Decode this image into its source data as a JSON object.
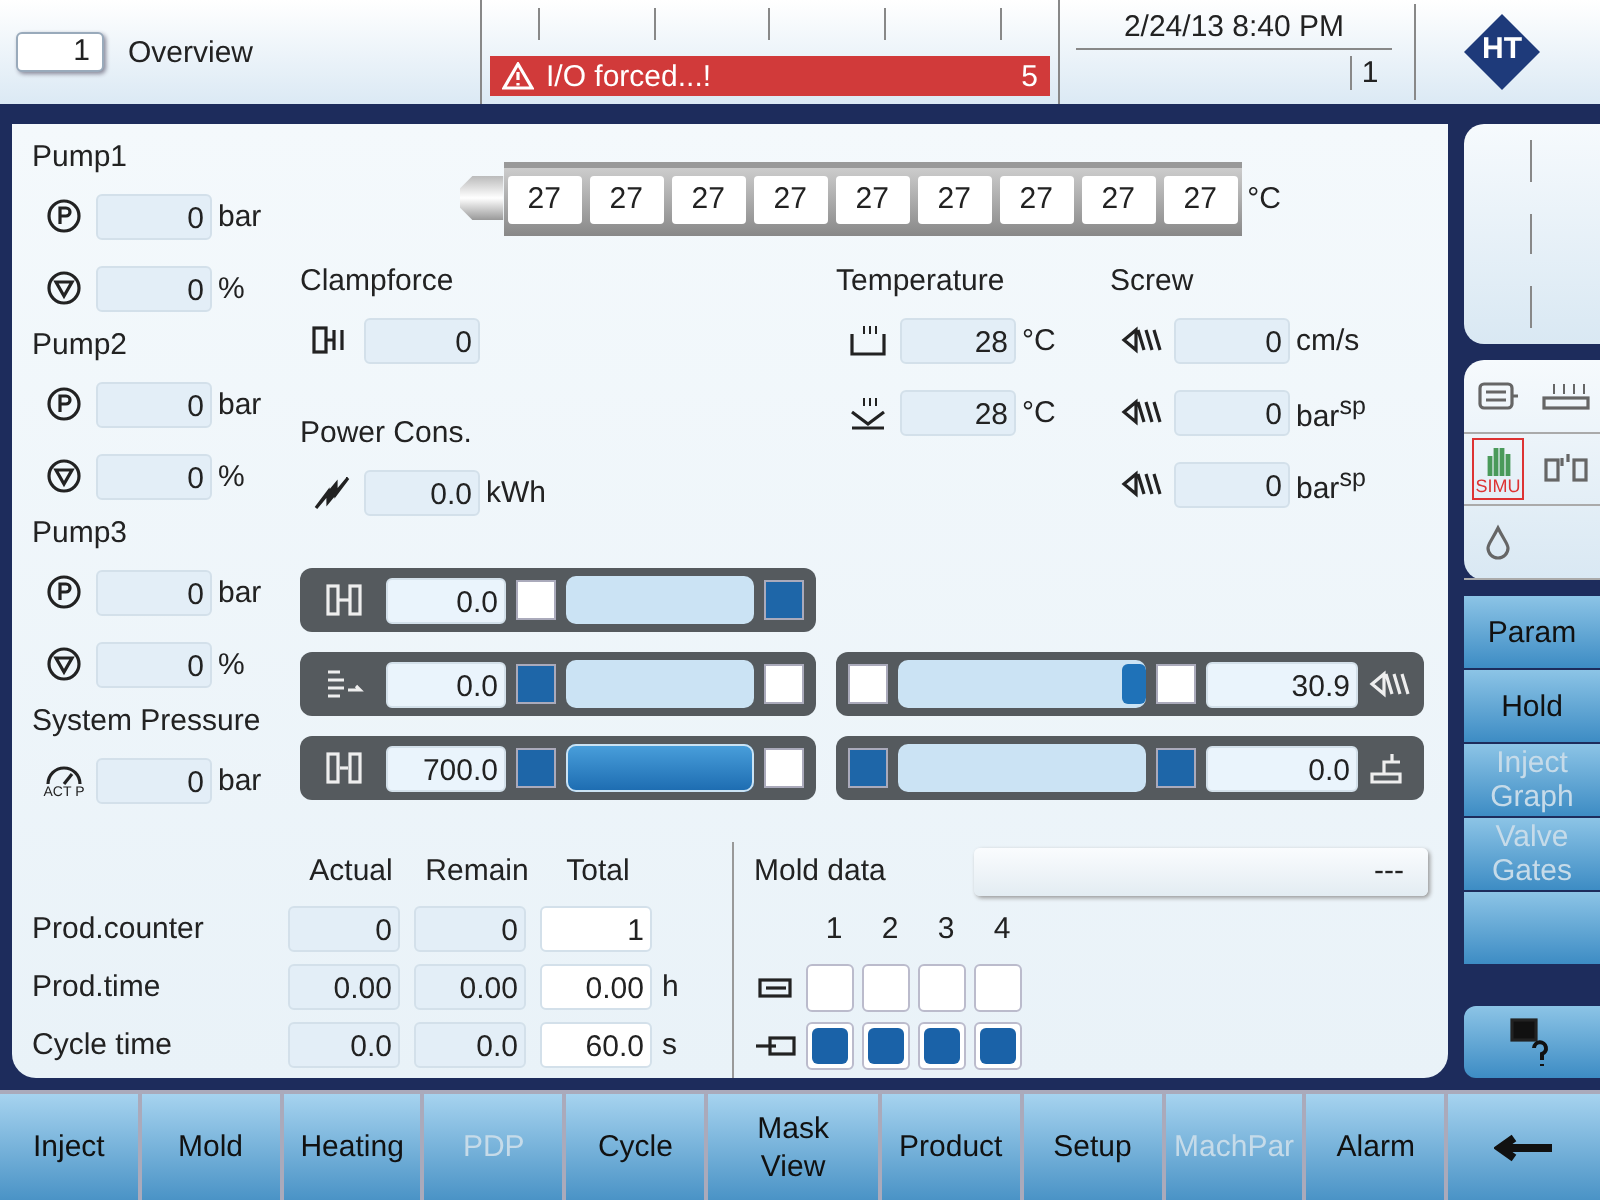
{
  "header": {
    "screen_number": "1",
    "screen_title": "Overview",
    "alarm": {
      "text": "I/O forced...!",
      "count": "5"
    },
    "datetime": "2/24/13 8:40 PM",
    "page_counter": "1",
    "logo": "HT"
  },
  "pumps": [
    {
      "name": "Pump1",
      "pressure": "0",
      "pressure_unit": "bar",
      "flow": "0",
      "flow_unit": "%"
    },
    {
      "name": "Pump2",
      "pressure": "0",
      "pressure_unit": "bar",
      "flow": "0",
      "flow_unit": "%"
    },
    {
      "name": "Pump3",
      "pressure": "0",
      "pressure_unit": "bar",
      "flow": "0",
      "flow_unit": "%"
    }
  ],
  "system_pressure": {
    "label": "System Pressure",
    "gauge_label": "ACT P",
    "value": "0",
    "unit": "bar"
  },
  "barrel": {
    "zones": [
      "27",
      "27",
      "27",
      "27",
      "27",
      "27",
      "27",
      "27",
      "27"
    ],
    "unit": "°C"
  },
  "clampforce": {
    "label": "Clampforce",
    "value": "0"
  },
  "power": {
    "label": "Power Cons.",
    "value": "0.0",
    "unit": "kWh"
  },
  "temperature": {
    "label": "Temperature",
    "readings": [
      {
        "value": "28",
        "unit": "°C"
      },
      {
        "value": "28",
        "unit": "°C"
      }
    ]
  },
  "screw": {
    "label": "Screw",
    "readings": [
      {
        "value": "0",
        "unit": "cm/s"
      },
      {
        "value": "0",
        "unit": "bar$^{sp}$"
      },
      {
        "value": "0",
        "unit": "bar$^{sp}$"
      }
    ]
  },
  "mold_bars": [
    {
      "value": "0.0",
      "left_on": false,
      "active": false,
      "right_on": true
    },
    {
      "value": "0.0",
      "left_on": true,
      "active": false,
      "right_on": false
    },
    {
      "value": "700.0",
      "left_on": true,
      "active": true,
      "right_on": false
    }
  ],
  "screw_bars": [
    {
      "value": "30.9",
      "left_on": false,
      "level": 1,
      "right_on": false
    },
    {
      "value": "0.0",
      "left_on": true,
      "level": 0,
      "right_on": true
    }
  ],
  "counters": {
    "columns": [
      "Actual",
      "Remain",
      "Total"
    ],
    "rows": [
      {
        "label": "Prod.counter",
        "cells": [
          "0",
          "0",
          "1"
        ]
      },
      {
        "label": "Prod.time",
        "cells": [
          "0.00",
          "0.00",
          "0.00"
        ],
        "unit": "h"
      },
      {
        "label": "Cycle time",
        "cells": [
          "0.0",
          "0.0",
          "60.0"
        ],
        "unit": "s"
      }
    ]
  },
  "mold_data": {
    "label": "Mold data",
    "value": "---",
    "columns": [
      "1",
      "2",
      "3",
      "4"
    ],
    "rows": [
      {
        "states": [
          false,
          false,
          false,
          false
        ]
      },
      {
        "states": [
          true,
          true,
          true,
          true
        ]
      }
    ]
  },
  "status_icons": {
    "simu_label": "SIMU",
    "simu_active": true
  },
  "side_buttons": [
    {
      "label": "Param",
      "disabled": false
    },
    {
      "label": "Hold",
      "disabled": false
    },
    {
      "label": "Inject Graph",
      "disabled": true
    },
    {
      "label": "Valve Gates",
      "disabled": true
    }
  ],
  "nav": [
    {
      "label": "Inject",
      "disabled": false
    },
    {
      "label": "Mold",
      "disabled": false
    },
    {
      "label": "Heating",
      "disabled": false
    },
    {
      "label": "PDP",
      "disabled": true
    },
    {
      "label": "Cycle",
      "disabled": false
    },
    {
      "label": "Mask View",
      "disabled": false
    },
    {
      "label": "Product",
      "disabled": false
    },
    {
      "label": "Setup",
      "disabled": false
    },
    {
      "label": "MachPar",
      "disabled": true
    },
    {
      "label": "Alarm",
      "disabled": false
    }
  ]
}
